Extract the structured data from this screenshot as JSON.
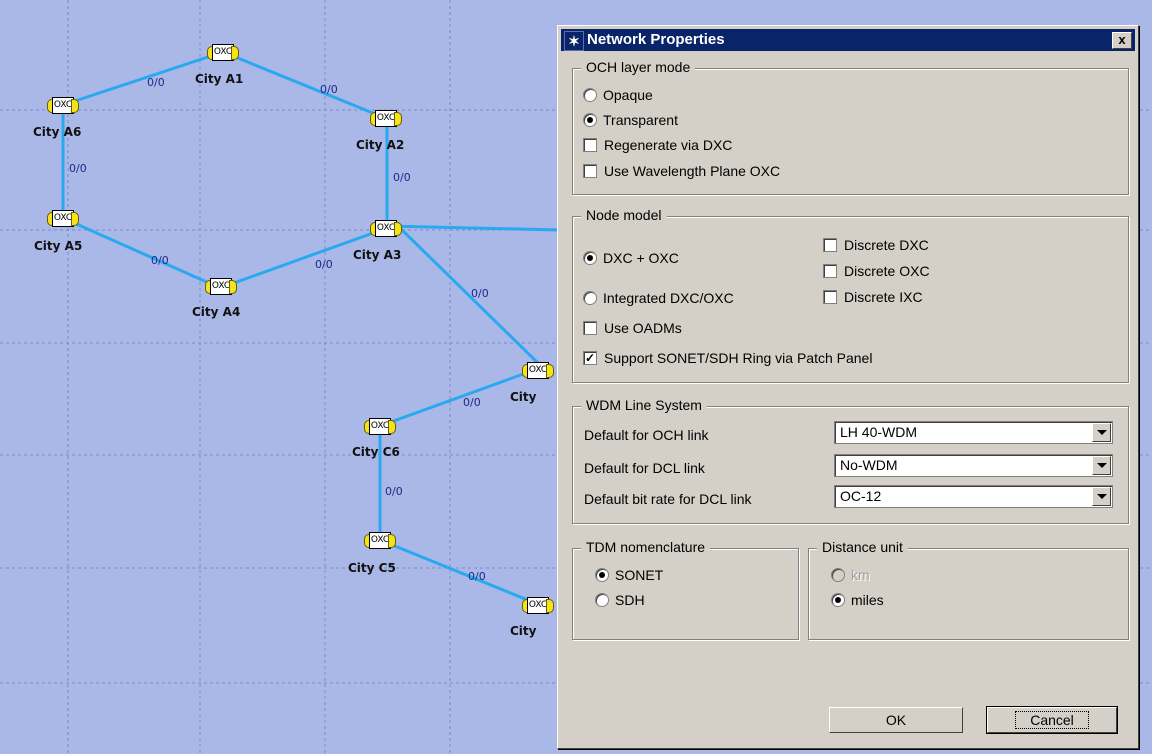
{
  "canvas": {
    "background": "#a9b8e6",
    "link_color": "#2aa8f0",
    "node_text": "OXC",
    "nodes": [
      {
        "id": "a1",
        "label": "City A1"
      },
      {
        "id": "a2",
        "label": "City A2"
      },
      {
        "id": "a3",
        "label": "City A3"
      },
      {
        "id": "a4",
        "label": "City A4"
      },
      {
        "id": "a5",
        "label": "City A5"
      },
      {
        "id": "a6",
        "label": "City A6"
      },
      {
        "id": "c6",
        "label": "City C6"
      },
      {
        "id": "c5",
        "label": "City C5"
      },
      {
        "id": "b",
        "label": "City"
      },
      {
        "id": "c",
        "label": "City"
      }
    ],
    "link_label": "0/0"
  },
  "dialog": {
    "title": "Network Properties",
    "close_label": "x",
    "och": {
      "legend": "OCH layer mode",
      "opaque": "Opaque",
      "transparent": "Transparent",
      "regenerate": "Regenerate via DXC",
      "wavelength": "Use Wavelength Plane OXC"
    },
    "node_model": {
      "legend": "Node model",
      "dxc_oxc": "DXC + OXC",
      "integrated": "Integrated DXC/OXC",
      "discrete_dxc": "Discrete DXC",
      "discrete_oxc": "Discrete OXC",
      "discrete_ixc": "Discrete IXC",
      "use_oadms": "Use OADMs",
      "sonet_ring": "Support SONET/SDH Ring via Patch Panel",
      "check_mark": "✓"
    },
    "wdm": {
      "legend": "WDM Line System",
      "och_label": "Default for OCH link",
      "och_value": "LH 40-WDM",
      "dcl_label": "Default for DCL link",
      "dcl_value": "No-WDM",
      "rate_label": "Default bit rate for DCL link",
      "rate_value": "OC-12"
    },
    "tdm": {
      "legend": "TDM nomenclature",
      "sonet": "SONET",
      "sdh": "SDH"
    },
    "distance": {
      "legend": "Distance unit",
      "km": "km",
      "miles": "miles"
    },
    "ok_label": "OK",
    "cancel_label": "Cancel"
  }
}
